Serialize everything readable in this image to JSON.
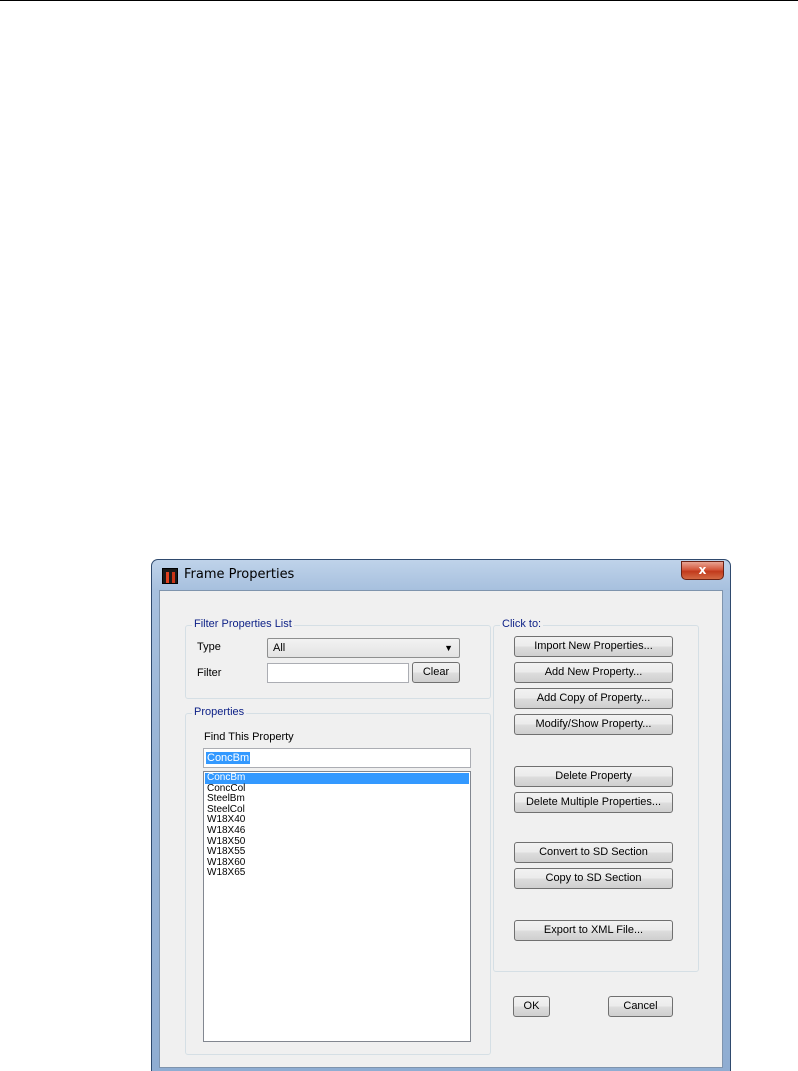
{
  "window": {
    "title": "Frame Properties",
    "close_glyph": "x"
  },
  "filter_group": {
    "label": "Filter Properties List",
    "type_label": "Type",
    "type_value": "All",
    "filter_label": "Filter",
    "filter_value": "",
    "clear_label": "Clear"
  },
  "properties_group": {
    "label": "Properties",
    "find_label": "Find This Property",
    "find_value": "ConcBm",
    "items": [
      "ConcBm",
      "ConcCol",
      "SteelBm",
      "SteelCol",
      "W18X40",
      "W18X46",
      "W18X50",
      "W18X55",
      "W18X60",
      "W18X65"
    ],
    "selected_index": 0
  },
  "actions_group": {
    "label": "Click to:",
    "import_label": "Import New Properties...",
    "add_label": "Add New Property...",
    "add_copy_label": "Add Copy of Property...",
    "modify_label": "Modify/Show Property...",
    "delete_label": "Delete Property",
    "delete_multiple_label": "Delete Multiple Properties...",
    "convert_label": "Convert to SD Section",
    "copy_sd_label": "Copy to SD Section",
    "export_label": "Export to XML File..."
  },
  "footer": {
    "ok_label": "OK",
    "cancel_label": "Cancel"
  }
}
